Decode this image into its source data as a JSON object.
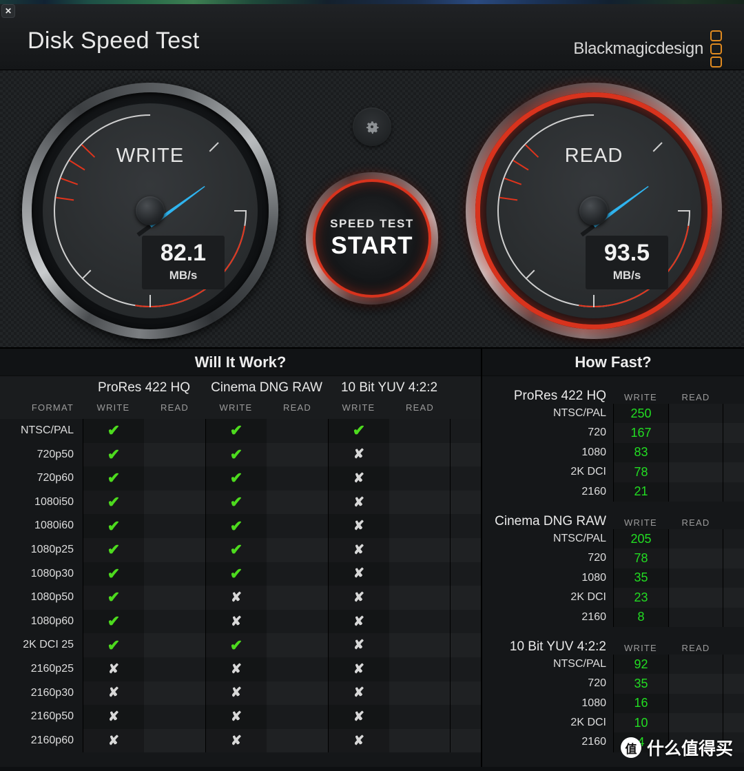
{
  "window": {
    "close_label": "✕",
    "title": "Disk Speed Test",
    "brand": "Blackmagicdesign"
  },
  "colors": {
    "accent_brand": "#e08a20",
    "needle": "#2fb4ef",
    "active_ring": "#d8331d",
    "pass": "#4ddb1e",
    "speed_value": "#22dd22",
    "panel_bg": "#151719"
  },
  "gauges": {
    "write": {
      "label": "WRITE",
      "value": "82.1",
      "unit": "MB/s",
      "needle_angle_deg": -126,
      "active": false
    },
    "read": {
      "label": "READ",
      "value": "93.5",
      "unit": "MB/s",
      "needle_angle_deg": -126,
      "active": true
    }
  },
  "center": {
    "gear_icon": "gear-icon",
    "start_small_label": "SPEED TEST",
    "start_big_label": "START"
  },
  "will_it_work": {
    "title": "Will It Work?",
    "format_header": "FORMAT",
    "codecs": [
      {
        "name": "ProRes 422 HQ",
        "sub": [
          "WRITE",
          "READ"
        ]
      },
      {
        "name": "Cinema DNG RAW",
        "sub": [
          "WRITE",
          "READ"
        ]
      },
      {
        "name": "10 Bit YUV 4:2:2",
        "sub": [
          "WRITE",
          "READ"
        ]
      }
    ],
    "rows": [
      {
        "format": "NTSC/PAL",
        "cells": [
          "ok",
          "",
          "ok",
          "",
          "ok",
          ""
        ]
      },
      {
        "format": "720p50",
        "cells": [
          "ok",
          "",
          "ok",
          "",
          "no",
          ""
        ]
      },
      {
        "format": "720p60",
        "cells": [
          "ok",
          "",
          "ok",
          "",
          "no",
          ""
        ]
      },
      {
        "format": "1080i50",
        "cells": [
          "ok",
          "",
          "ok",
          "",
          "no",
          ""
        ]
      },
      {
        "format": "1080i60",
        "cells": [
          "ok",
          "",
          "ok",
          "",
          "no",
          ""
        ]
      },
      {
        "format": "1080p25",
        "cells": [
          "ok",
          "",
          "ok",
          "",
          "no",
          ""
        ]
      },
      {
        "format": "1080p30",
        "cells": [
          "ok",
          "",
          "ok",
          "",
          "no",
          ""
        ]
      },
      {
        "format": "1080p50",
        "cells": [
          "ok",
          "",
          "no",
          "",
          "no",
          ""
        ]
      },
      {
        "format": "1080p60",
        "cells": [
          "ok",
          "",
          "no",
          "",
          "no",
          ""
        ]
      },
      {
        "format": "2K DCI 25",
        "cells": [
          "ok",
          "",
          "ok",
          "",
          "no",
          ""
        ]
      },
      {
        "format": "2160p25",
        "cells": [
          "no",
          "",
          "no",
          "",
          "no",
          ""
        ]
      },
      {
        "format": "2160p30",
        "cells": [
          "no",
          "",
          "no",
          "",
          "no",
          ""
        ]
      },
      {
        "format": "2160p50",
        "cells": [
          "no",
          "",
          "no",
          "",
          "no",
          ""
        ]
      },
      {
        "format": "2160p60",
        "cells": [
          "no",
          "",
          "no",
          "",
          "no",
          ""
        ]
      }
    ],
    "mark_glyphs": {
      "ok": "✔",
      "no": "✘"
    }
  },
  "how_fast": {
    "title": "How Fast?",
    "sub_write": "WRITE",
    "sub_read": "READ",
    "groups": [
      {
        "name": "ProRes 422 HQ",
        "rows": [
          {
            "format": "NTSC/PAL",
            "write": "250",
            "read": ""
          },
          {
            "format": "720",
            "write": "167",
            "read": ""
          },
          {
            "format": "1080",
            "write": "83",
            "read": ""
          },
          {
            "format": "2K DCI",
            "write": "78",
            "read": ""
          },
          {
            "format": "2160",
            "write": "21",
            "read": ""
          }
        ]
      },
      {
        "name": "Cinema DNG RAW",
        "rows": [
          {
            "format": "NTSC/PAL",
            "write": "205",
            "read": ""
          },
          {
            "format": "720",
            "write": "78",
            "read": ""
          },
          {
            "format": "1080",
            "write": "35",
            "read": ""
          },
          {
            "format": "2K DCI",
            "write": "23",
            "read": ""
          },
          {
            "format": "2160",
            "write": "8",
            "read": ""
          }
        ]
      },
      {
        "name": "10 Bit YUV 4:2:2",
        "rows": [
          {
            "format": "NTSC/PAL",
            "write": "92",
            "read": ""
          },
          {
            "format": "720",
            "write": "35",
            "read": ""
          },
          {
            "format": "1080",
            "write": "16",
            "read": ""
          },
          {
            "format": "2K DCI",
            "write": "10",
            "read": ""
          },
          {
            "format": "2160",
            "write": "4",
            "read": ""
          }
        ]
      }
    ]
  },
  "watermark": {
    "logo": "值",
    "text": "什么值得买"
  }
}
